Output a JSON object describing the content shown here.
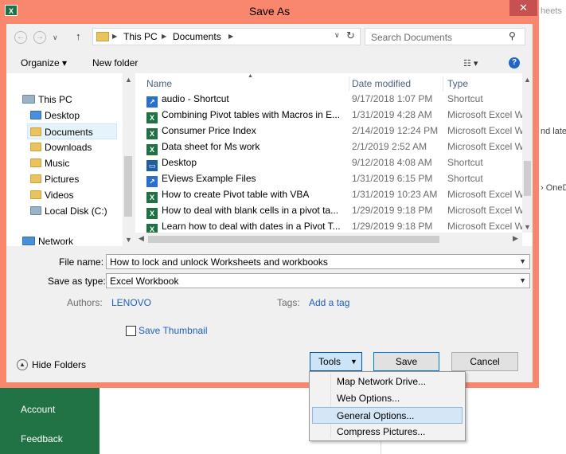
{
  "background": {
    "nav_items": [
      "Account",
      "Feedback"
    ],
    "right_fragments": [
      "heets",
      "nd late",
      "OneD"
    ]
  },
  "dialog": {
    "title": "Save As",
    "app_icon": "X",
    "close_glyph": "✕"
  },
  "address": {
    "back_glyph": "←",
    "forward_glyph": "→",
    "recent_glyph": "∨",
    "up_glyph": "↑",
    "crumbs": [
      "This PC",
      "Documents"
    ],
    "crumb_sep": "▶",
    "dropdown_glyph": "∨",
    "refresh_glyph": "↻",
    "search_placeholder": "Search Documents",
    "search_glyph": "⚲"
  },
  "toolbar": {
    "organize": "Organize ▾",
    "new_folder": "New folder",
    "view_glyph": "☷ ▾",
    "help_glyph": "?"
  },
  "navpane": {
    "items": [
      {
        "label": "This PC",
        "icon": "computer-icon"
      },
      {
        "label": "Desktop",
        "icon": "folder-icon"
      },
      {
        "label": "Documents",
        "icon": "folder-icon"
      },
      {
        "label": "Downloads",
        "icon": "folder-icon"
      },
      {
        "label": "Music",
        "icon": "folder-icon"
      },
      {
        "label": "Pictures",
        "icon": "folder-icon"
      },
      {
        "label": "Videos",
        "icon": "folder-icon"
      },
      {
        "label": "Local Disk (C:)",
        "icon": "drive-icon"
      },
      {
        "label": "Network",
        "icon": "network-icon"
      }
    ],
    "selected": "Documents"
  },
  "filelist": {
    "columns": [
      "Name",
      "Date modified",
      "Type"
    ],
    "rows": [
      {
        "name": "audio - Shortcut",
        "date": "9/17/2018 1:07 PM",
        "type": "Shortcut",
        "icon": "sc"
      },
      {
        "name": "Combining Pivot tables with Macros in E...",
        "date": "1/31/2019 4:28 AM",
        "type": "Microsoft Excel W",
        "icon": "xl"
      },
      {
        "name": "Consumer Price Index",
        "date": "2/14/2019 12:24 PM",
        "type": "Microsoft Excel W",
        "icon": "xl"
      },
      {
        "name": "Data sheet for Ms work",
        "date": "2/1/2019 2:52 AM",
        "type": "Microsoft Excel W",
        "icon": "xl"
      },
      {
        "name": "Desktop",
        "date": "9/12/2018 4:08 AM",
        "type": "Shortcut",
        "icon": "dk"
      },
      {
        "name": "EViews Example Files",
        "date": "1/31/2019 6:15 PM",
        "type": "Shortcut",
        "icon": "sc"
      },
      {
        "name": "How to create Pivot table with VBA",
        "date": "1/31/2019 10:23 AM",
        "type": "Microsoft Excel W",
        "icon": "xl"
      },
      {
        "name": "How to deal with blank cells in a pivot ta...",
        "date": "1/29/2019 9:18 PM",
        "type": "Microsoft Excel W",
        "icon": "xl"
      },
      {
        "name": "Learn how to deal with dates in a Pivot T...",
        "date": "1/29/2019 9:18 PM",
        "type": "Microsoft Excel W",
        "icon": "xl"
      }
    ]
  },
  "form": {
    "file_name_label": "File name:",
    "file_name_value": "How to lock and unlock Worksheets and workbooks",
    "save_type_label": "Save as type:",
    "save_type_value": "Excel Workbook",
    "authors_label": "Authors:",
    "authors_value": "LENOVO",
    "tags_label": "Tags:",
    "tags_value": "Add a tag",
    "thumbnail_label": "Save Thumbnail"
  },
  "footer": {
    "hide_folders": "Hide Folders",
    "tools": "Tools",
    "save": "Save",
    "cancel": "Cancel"
  },
  "tools_menu": {
    "items": [
      "Map Network Drive...",
      "Web Options...",
      "General Options...",
      "Compress Pictures..."
    ],
    "highlighted_index": 2
  },
  "colors": {
    "excel_green": "#217346",
    "dialog_frame": "#f8876e",
    "close_red": "#c75050",
    "link_blue": "#1f5fbf"
  }
}
